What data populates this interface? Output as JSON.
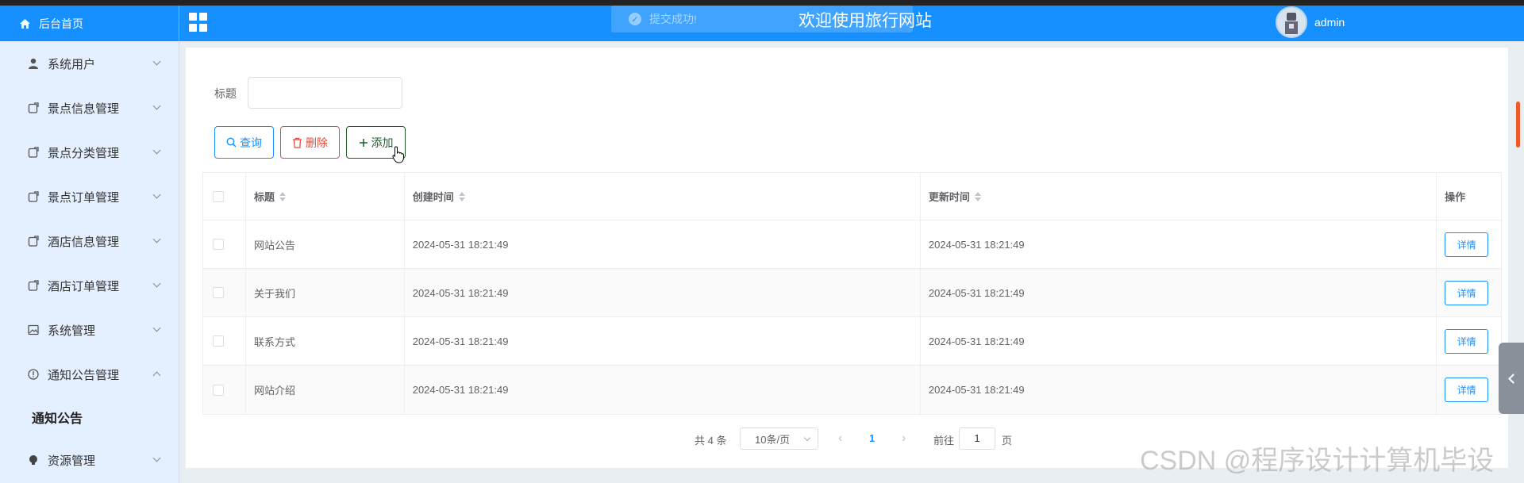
{
  "header": {
    "home_label": "后台首页",
    "toast": "提交成功!",
    "site_title": "欢迎使用旅行网站",
    "username": "admin"
  },
  "sidebar": {
    "items": [
      {
        "label": "系统用户",
        "icon": "user-icon",
        "expanded": false
      },
      {
        "label": "景点信息管理",
        "icon": "document-icon",
        "expanded": false
      },
      {
        "label": "景点分类管理",
        "icon": "document-icon",
        "expanded": false
      },
      {
        "label": "景点订单管理",
        "icon": "document-icon",
        "expanded": false
      },
      {
        "label": "酒店信息管理",
        "icon": "document-icon",
        "expanded": false
      },
      {
        "label": "酒店订单管理",
        "icon": "document-icon",
        "expanded": false
      },
      {
        "label": "系统管理",
        "icon": "image-icon",
        "expanded": false
      },
      {
        "label": "通知公告管理",
        "icon": "info-circle-icon",
        "expanded": true
      },
      {
        "label": "资源管理",
        "icon": "bulb-icon",
        "expanded": false
      }
    ],
    "submenu_active": "通知公告"
  },
  "search": {
    "label": "标题",
    "value": ""
  },
  "buttons": {
    "query": "查询",
    "delete": "删除",
    "add": "添加"
  },
  "table": {
    "headers": [
      "标题",
      "创建时间",
      "更新时间",
      "操作"
    ],
    "rows": [
      {
        "title": "网站公告",
        "created": "2024-05-31 18:21:49",
        "updated": "2024-05-31 18:21:49",
        "action": "详情"
      },
      {
        "title": "关于我们",
        "created": "2024-05-31 18:21:49",
        "updated": "2024-05-31 18:21:49",
        "action": "详情"
      },
      {
        "title": "联系方式",
        "created": "2024-05-31 18:21:49",
        "updated": "2024-05-31 18:21:49",
        "action": "详情"
      },
      {
        "title": "网站介绍",
        "created": "2024-05-31 18:21:49",
        "updated": "2024-05-31 18:21:49",
        "action": "详情"
      }
    ]
  },
  "pagination": {
    "total": "共 4 条",
    "page_size": "10条/页",
    "current_page": "1",
    "goto_label": "前往",
    "goto_value": "1",
    "page_suffix": "页"
  },
  "watermark": "CSDN @程序设计计算机毕设",
  "colors": {
    "header_bg": "#1690ff",
    "sidebar_bg": "#e4efff",
    "primary": "#1890ff",
    "danger": "#e64a3a",
    "success_dark": "#1f5c2a"
  }
}
